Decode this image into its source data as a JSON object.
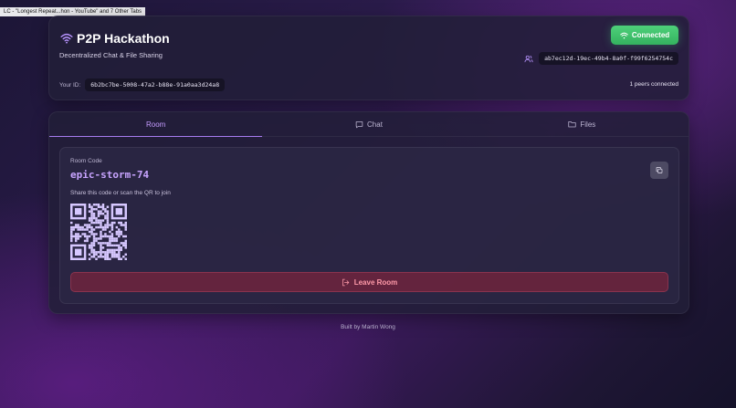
{
  "browser": {
    "tab_tooltip": "LC - \"Longest Repeat...hon - YouTube\" and 7 Other Tabs"
  },
  "header": {
    "title": "P2P Hackathon",
    "subtitle": "Decentralized Chat & File Sharing",
    "status_label": "Connected",
    "peer_id": "ab7ec12d-19ec-49b4-8a0f-f99f6254754c",
    "your_id_label": "Your ID:",
    "your_id": "6b2bc7be-5008-47a2-b88e-91a0aa3d24a8",
    "peers_connected": "1 peers connected"
  },
  "tabs": [
    {
      "label": "Room",
      "icon": "none",
      "active": true
    },
    {
      "label": "Chat",
      "icon": "chat-bubble-icon",
      "active": false
    },
    {
      "label": "Files",
      "icon": "folder-icon",
      "active": false
    }
  ],
  "room": {
    "code_label": "Room Code",
    "code": "epic-storm-74",
    "share_hint": "Share this code or scan the QR to join",
    "leave_label": "Leave Room"
  },
  "footer": {
    "credit": "Built by Martin Wong"
  },
  "colors": {
    "accent": "#c8a4ff",
    "connected": "#3fc46a",
    "danger": "#ff9aa9"
  }
}
